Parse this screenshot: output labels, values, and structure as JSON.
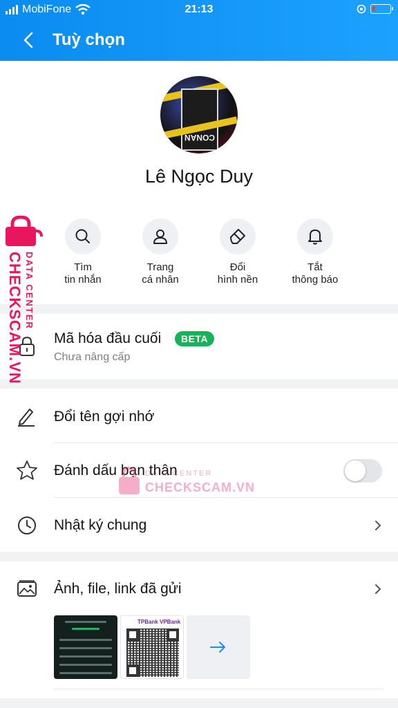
{
  "status_bar": {
    "carrier": "MobiFone",
    "time": "21:13"
  },
  "header": {
    "title": "Tuỳ chọn"
  },
  "profile": {
    "name": "Lê Ngọc Duy",
    "avatar_text": "CONAN"
  },
  "actions": [
    {
      "label_line1": "Tìm",
      "label_line2": "tin nhắn",
      "icon": "search-icon"
    },
    {
      "label_line1": "Trang",
      "label_line2": "cá nhân",
      "icon": "person-icon"
    },
    {
      "label_line1": "Đổi",
      "label_line2": "hình nền",
      "icon": "paint-brush-icon"
    },
    {
      "label_line1": "Tắt",
      "label_line2": "thông báo",
      "icon": "bell-icon"
    }
  ],
  "encryption": {
    "title": "Mã hóa đầu cuối",
    "badge": "BETA",
    "subtitle": "Chưa nâng cấp",
    "icon": "lock-icon"
  },
  "menu": {
    "rename": {
      "label": "Đổi tên gợi nhớ",
      "icon": "pencil-icon"
    },
    "best_friend": {
      "label": "Đánh dấu bạn thân",
      "icon": "star-icon",
      "toggle_on": false
    },
    "diary": {
      "label": "Nhật ký chung",
      "icon": "clock-icon"
    },
    "media": {
      "label": "Ảnh, file, link đã gửi",
      "icon": "image-folder-icon"
    }
  },
  "media_thumbs": {
    "bank_name": "TPBank VPBank"
  },
  "watermark": {
    "line1": "DATA CENTER",
    "line2": "CHECKSCAM.VN"
  },
  "colors": {
    "header": "#0a8cf0",
    "accent_green": "#17b35a",
    "watermark": "#e8175d"
  }
}
